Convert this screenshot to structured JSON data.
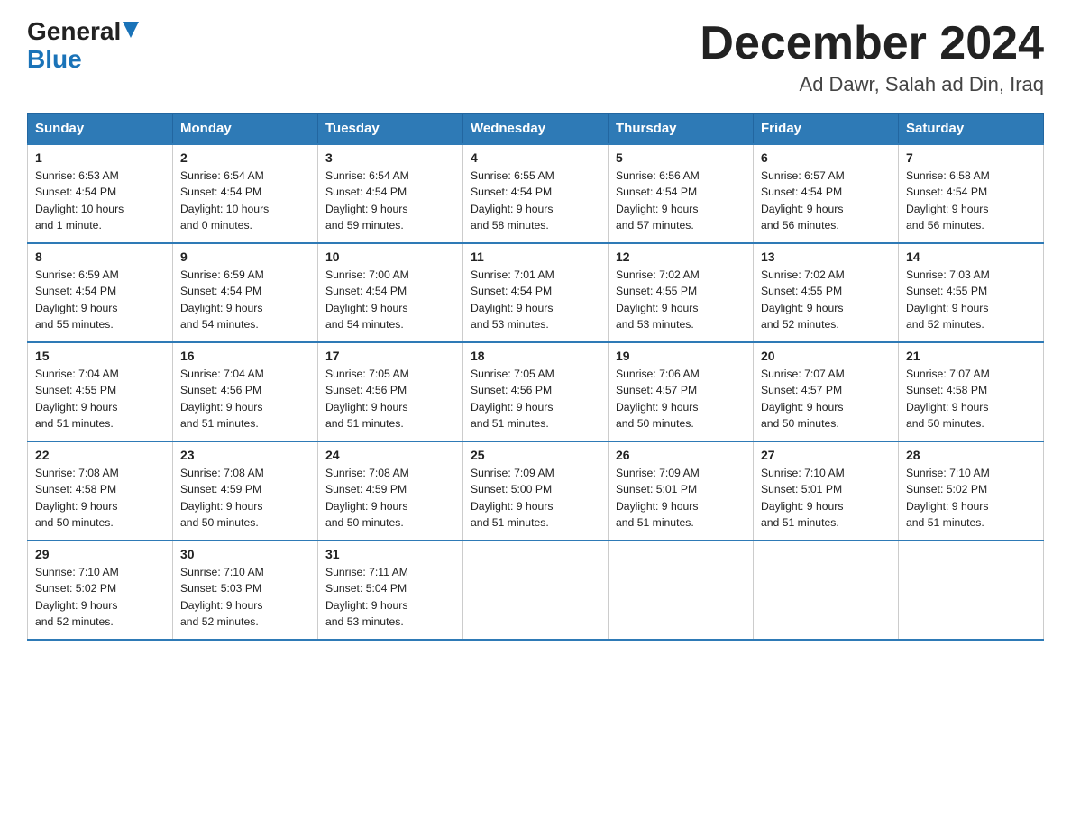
{
  "header": {
    "logo_general": "General",
    "logo_blue": "Blue",
    "month_title": "December 2024",
    "location": "Ad Dawr, Salah ad Din, Iraq"
  },
  "weekdays": [
    "Sunday",
    "Monday",
    "Tuesday",
    "Wednesday",
    "Thursday",
    "Friday",
    "Saturday"
  ],
  "weeks": [
    [
      {
        "day": "1",
        "sunrise": "6:53 AM",
        "sunset": "4:54 PM",
        "daylight": "10 hours and 1 minute."
      },
      {
        "day": "2",
        "sunrise": "6:54 AM",
        "sunset": "4:54 PM",
        "daylight": "10 hours and 0 minutes."
      },
      {
        "day": "3",
        "sunrise": "6:54 AM",
        "sunset": "4:54 PM",
        "daylight": "9 hours and 59 minutes."
      },
      {
        "day": "4",
        "sunrise": "6:55 AM",
        "sunset": "4:54 PM",
        "daylight": "9 hours and 58 minutes."
      },
      {
        "day": "5",
        "sunrise": "6:56 AM",
        "sunset": "4:54 PM",
        "daylight": "9 hours and 57 minutes."
      },
      {
        "day": "6",
        "sunrise": "6:57 AM",
        "sunset": "4:54 PM",
        "daylight": "9 hours and 56 minutes."
      },
      {
        "day": "7",
        "sunrise": "6:58 AM",
        "sunset": "4:54 PM",
        "daylight": "9 hours and 56 minutes."
      }
    ],
    [
      {
        "day": "8",
        "sunrise": "6:59 AM",
        "sunset": "4:54 PM",
        "daylight": "9 hours and 55 minutes."
      },
      {
        "day": "9",
        "sunrise": "6:59 AM",
        "sunset": "4:54 PM",
        "daylight": "9 hours and 54 minutes."
      },
      {
        "day": "10",
        "sunrise": "7:00 AM",
        "sunset": "4:54 PM",
        "daylight": "9 hours and 54 minutes."
      },
      {
        "day": "11",
        "sunrise": "7:01 AM",
        "sunset": "4:54 PM",
        "daylight": "9 hours and 53 minutes."
      },
      {
        "day": "12",
        "sunrise": "7:02 AM",
        "sunset": "4:55 PM",
        "daylight": "9 hours and 53 minutes."
      },
      {
        "day": "13",
        "sunrise": "7:02 AM",
        "sunset": "4:55 PM",
        "daylight": "9 hours and 52 minutes."
      },
      {
        "day": "14",
        "sunrise": "7:03 AM",
        "sunset": "4:55 PM",
        "daylight": "9 hours and 52 minutes."
      }
    ],
    [
      {
        "day": "15",
        "sunrise": "7:04 AM",
        "sunset": "4:55 PM",
        "daylight": "9 hours and 51 minutes."
      },
      {
        "day": "16",
        "sunrise": "7:04 AM",
        "sunset": "4:56 PM",
        "daylight": "9 hours and 51 minutes."
      },
      {
        "day": "17",
        "sunrise": "7:05 AM",
        "sunset": "4:56 PM",
        "daylight": "9 hours and 51 minutes."
      },
      {
        "day": "18",
        "sunrise": "7:05 AM",
        "sunset": "4:56 PM",
        "daylight": "9 hours and 51 minutes."
      },
      {
        "day": "19",
        "sunrise": "7:06 AM",
        "sunset": "4:57 PM",
        "daylight": "9 hours and 50 minutes."
      },
      {
        "day": "20",
        "sunrise": "7:07 AM",
        "sunset": "4:57 PM",
        "daylight": "9 hours and 50 minutes."
      },
      {
        "day": "21",
        "sunrise": "7:07 AM",
        "sunset": "4:58 PM",
        "daylight": "9 hours and 50 minutes."
      }
    ],
    [
      {
        "day": "22",
        "sunrise": "7:08 AM",
        "sunset": "4:58 PM",
        "daylight": "9 hours and 50 minutes."
      },
      {
        "day": "23",
        "sunrise": "7:08 AM",
        "sunset": "4:59 PM",
        "daylight": "9 hours and 50 minutes."
      },
      {
        "day": "24",
        "sunrise": "7:08 AM",
        "sunset": "4:59 PM",
        "daylight": "9 hours and 50 minutes."
      },
      {
        "day": "25",
        "sunrise": "7:09 AM",
        "sunset": "5:00 PM",
        "daylight": "9 hours and 51 minutes."
      },
      {
        "day": "26",
        "sunrise": "7:09 AM",
        "sunset": "5:01 PM",
        "daylight": "9 hours and 51 minutes."
      },
      {
        "day": "27",
        "sunrise": "7:10 AM",
        "sunset": "5:01 PM",
        "daylight": "9 hours and 51 minutes."
      },
      {
        "day": "28",
        "sunrise": "7:10 AM",
        "sunset": "5:02 PM",
        "daylight": "9 hours and 51 minutes."
      }
    ],
    [
      {
        "day": "29",
        "sunrise": "7:10 AM",
        "sunset": "5:02 PM",
        "daylight": "9 hours and 52 minutes."
      },
      {
        "day": "30",
        "sunrise": "7:10 AM",
        "sunset": "5:03 PM",
        "daylight": "9 hours and 52 minutes."
      },
      {
        "day": "31",
        "sunrise": "7:11 AM",
        "sunset": "5:04 PM",
        "daylight": "9 hours and 53 minutes."
      },
      null,
      null,
      null,
      null
    ]
  ],
  "labels": {
    "sunrise": "Sunrise:",
    "sunset": "Sunset:",
    "daylight": "Daylight:"
  }
}
